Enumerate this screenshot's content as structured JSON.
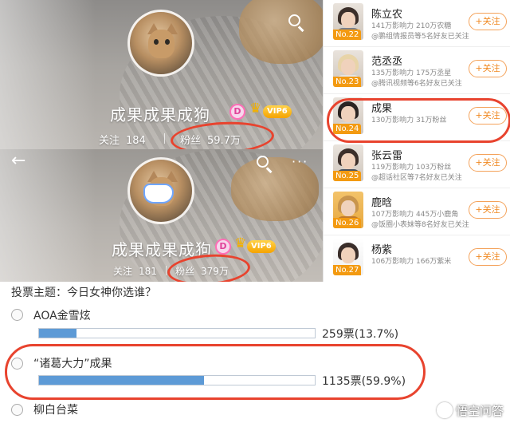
{
  "profile_top": {
    "name": "成果成果成狗",
    "badge_glyph": "D",
    "vip_label": "VIP6",
    "following_label": "关注",
    "following_value": "184",
    "fans_label": "粉丝",
    "fans_value": "59.7万"
  },
  "profile_bottom": {
    "name": "成果成果成狗",
    "badge_glyph": "D",
    "vip_label": "VIP6",
    "following_label": "关注",
    "following_value": "181",
    "fans_label": "粉丝",
    "fans_value": "379万",
    "back_glyph": "←",
    "more_glyph": "···"
  },
  "ranking": {
    "follow_label": "+关注",
    "items": [
      {
        "rank": "No.22",
        "name": "陈立农",
        "stats": "141万影响力 210万农糖",
        "note": ""
      },
      {
        "rank": "No.23",
        "name": "范丞丞",
        "stats": "135万影响力 175万丞星",
        "note": "@腾讯视频等6名好友已关注"
      },
      {
        "rank": "No.24",
        "name": "成果",
        "stats": "130万影响力 31万粉丝",
        "note": ""
      },
      {
        "rank": "No.25",
        "name": "张云雷",
        "stats": "119万影响力 103万粉丝",
        "note": "@超话社区等7名好友已关注"
      },
      {
        "rank": "No.26",
        "name": "鹿晗",
        "stats": "107万影响力 445万小鹿角",
        "note": "@饭圈小表妹等8名好友已关注"
      },
      {
        "rank": "No.27",
        "name": "杨紫",
        "stats": "106万影响力 166万紫米",
        "note": ""
      }
    ],
    "partial_top_note": "@鹏组情报员等5名好友已关注"
  },
  "poll": {
    "title": "投票主题：今日女神你选谁？",
    "options": [
      {
        "label": "AOA金雪炫",
        "votes_text": "259票(13.7%)",
        "percent": 13.7
      },
      {
        "label": "“诸葛大力”成果",
        "votes_text": "1135票(59.9%)",
        "percent": 59.9
      },
      {
        "label": "柳白台菜",
        "votes_text": ""
      }
    ]
  },
  "watermark": {
    "text": "悟空问答"
  },
  "colors": {
    "accent_orange": "#f08a24",
    "rank_badge": "#f39a11",
    "bar_fill": "#5d9ad6",
    "highlight_red": "#e8432e"
  }
}
